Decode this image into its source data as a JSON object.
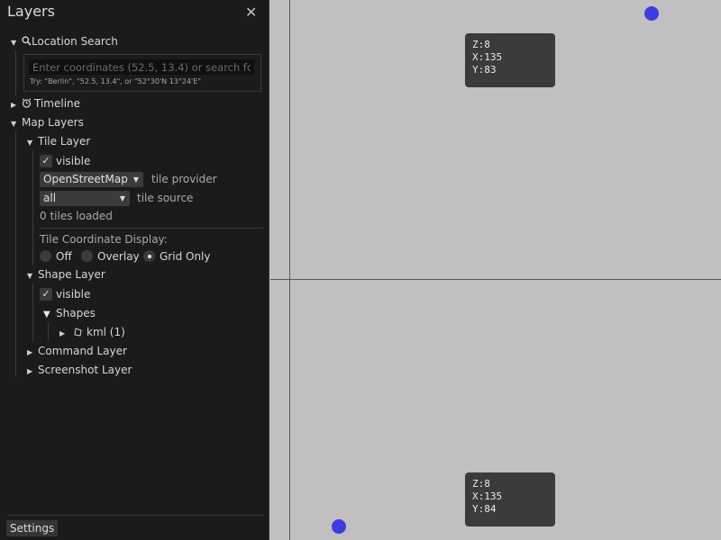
{
  "panel": {
    "title": "Layers",
    "close_glyph": "✕",
    "location_search": {
      "label": "Location Search",
      "placeholder": "Enter coordinates (52.5, 13.4) or search for a",
      "hint": "Try: \"Berlin\", \"52.5, 13.4\", or \"52°30'N 13°24'E\""
    },
    "timeline": {
      "label": "Timeline"
    },
    "map_layers": {
      "label": "Map Layers",
      "tile_layer": {
        "label": "Tile Layer",
        "visible_label": "visible",
        "visible": true,
        "provider_value": "OpenStreetMap",
        "provider_label": "tile provider",
        "source_value": "all",
        "source_label": "tile source",
        "tiles_loaded": "0 tiles loaded",
        "coord_display_label": "Tile Coordinate Display:",
        "coord_options": [
          "Off",
          "Overlay",
          "Grid Only"
        ],
        "coord_selected": "Grid Only"
      },
      "shape_layer": {
        "label": "Shape Layer",
        "visible_label": "visible",
        "visible": true,
        "shapes_label": "Shapes",
        "kml_label": "kml (1)"
      },
      "command_layer": {
        "label": "Command Layer"
      },
      "screenshot_layer": {
        "label": "Screenshot Layer"
      }
    },
    "settings_label": "Settings",
    "icons": {
      "search": "search-icon",
      "alarm": "alarm-clock-icon",
      "shape": "shape-icon",
      "checkmark": "checkmark-icon"
    }
  },
  "map": {
    "tiles": [
      {
        "z": "Z:8",
        "x": "X:135",
        "y": "Y:83"
      },
      {
        "z": "Z:8",
        "x": "X:135",
        "y": "Y:84"
      }
    ],
    "point_color": "#3c3ce0",
    "background_color": "#c1bfbf"
  }
}
